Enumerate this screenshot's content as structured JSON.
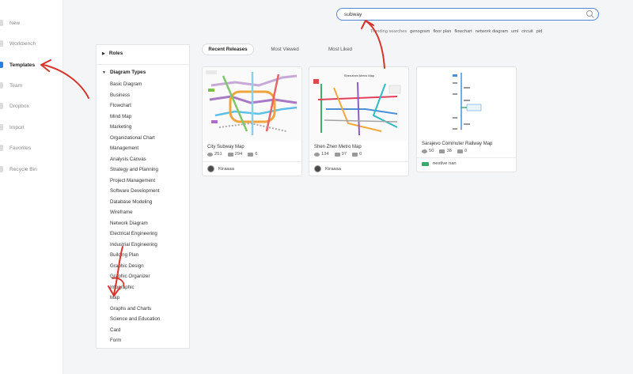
{
  "sidebar": {
    "items": [
      {
        "label": "New",
        "active": false
      },
      {
        "label": "Workbench",
        "active": false
      },
      {
        "label": "Templates",
        "active": true
      },
      {
        "label": "Team",
        "active": false
      },
      {
        "label": "Dropbox",
        "active": false
      },
      {
        "label": "Import",
        "active": false
      },
      {
        "label": "Favorites",
        "active": false
      },
      {
        "label": "Recycle Bin",
        "active": false
      }
    ]
  },
  "search": {
    "value": "subway",
    "trending_label": "Trending searches",
    "trending": [
      "genogram",
      "floor plan",
      "flowchart",
      "network diagram",
      "uml",
      "circuit",
      "pid"
    ]
  },
  "categories": {
    "roles_label": "Roles",
    "diagram_types_label": "Diagram Types",
    "items": [
      "Basic Diagram",
      "Business",
      "Flowchart",
      "Mind Map",
      "Marketing",
      "Organizational Chart",
      "Management",
      "Analysis Canvas",
      "Strategy and Planning",
      "Project Management",
      "Software Development",
      "Database Modeling",
      "Wireframe",
      "Network Diagram",
      "Electrical Engineering",
      "Industrial Engineering",
      "Building Plan",
      "Graphic Design",
      "Graphic Organizer",
      "Infographic",
      "Map",
      "Graphs and Charts",
      "Science and Education",
      "Card",
      "Form"
    ]
  },
  "tabs": [
    {
      "label": "Recent Releases",
      "active": true
    },
    {
      "label": "Most Viewed",
      "active": false
    },
    {
      "label": "Most Liked",
      "active": false
    }
  ],
  "cards": [
    {
      "title": "City Subway Map",
      "views": "251",
      "copies": "294",
      "likes": "6",
      "author": "Kiraaaa"
    },
    {
      "title": "Shen Zhen Metro Map",
      "views": "134",
      "copies": "97",
      "likes": "0",
      "author": "Kiraaaa"
    },
    {
      "title": "Sarajevo Commuter Railway Map",
      "views": "50",
      "copies": "38",
      "likes": "0",
      "author": "nestive nan"
    }
  ],
  "thumbnails": {
    "shenzhen_heading": "Shenzhen Metro Map"
  },
  "colors": {
    "accent": "#2a7de1",
    "annotation": "#d6332b"
  }
}
